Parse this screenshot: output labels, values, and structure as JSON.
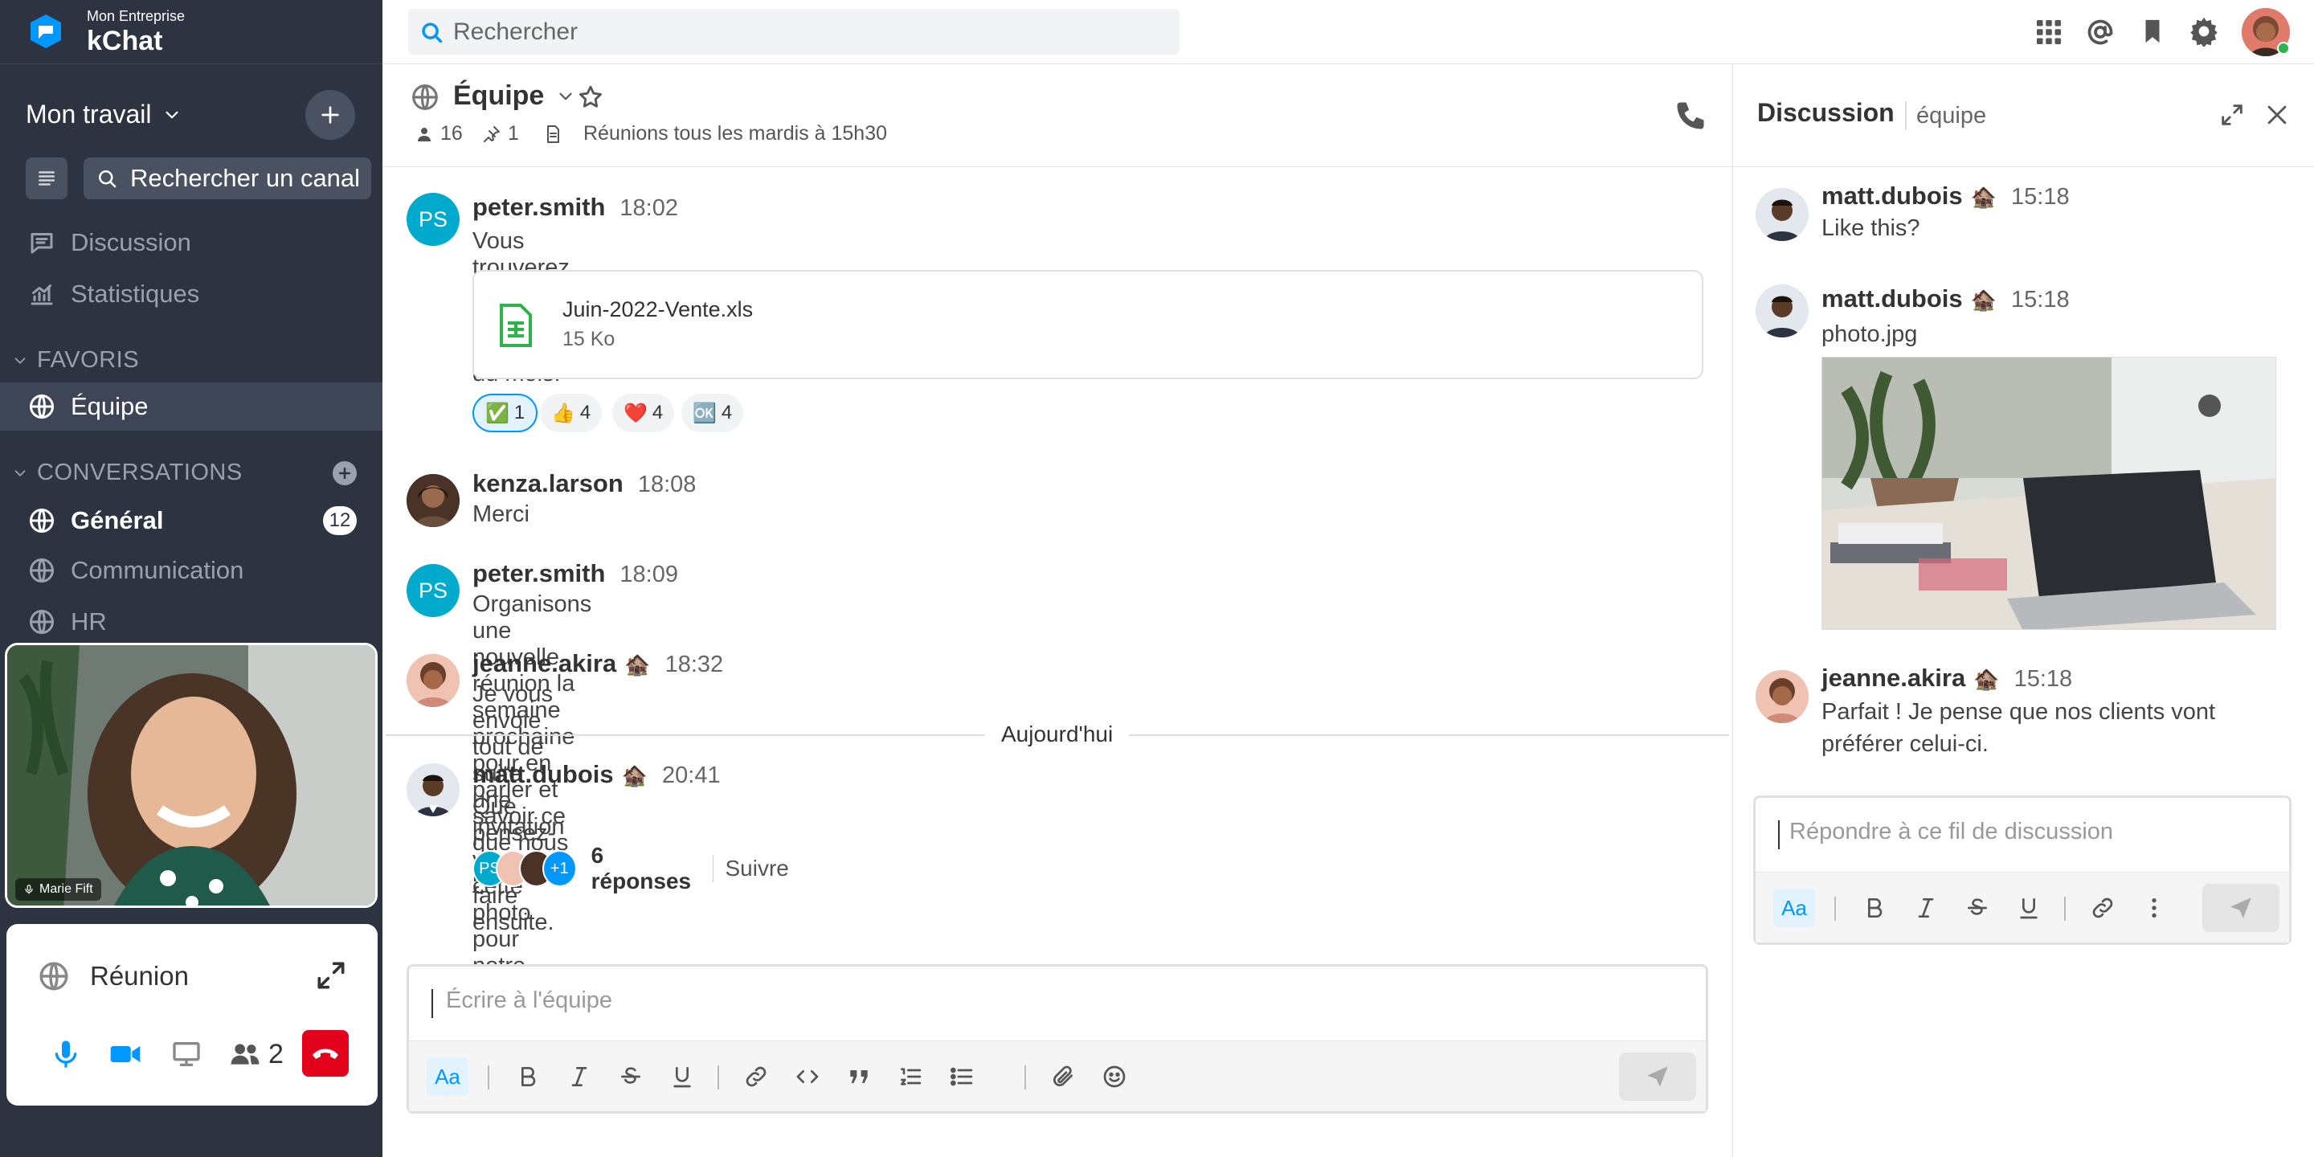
{
  "workspace": {
    "org": "Mon Entreprise",
    "app": "kChat"
  },
  "sidebar": {
    "work_menu": "Mon travail",
    "channel_search": "Rechercher un canal",
    "nav": [
      {
        "label": "Discussion",
        "icon": "threads-icon"
      },
      {
        "label": "Statistiques",
        "icon": "insights-icon"
      }
    ],
    "favorites_title": "FAVORIS",
    "favorites": [
      {
        "label": "Équipe"
      }
    ],
    "conversations_title": "CONVERSATIONS",
    "conversations": [
      {
        "label": "Général",
        "badge": "12",
        "unread": true
      },
      {
        "label": "Communication"
      },
      {
        "label": "HR"
      }
    ]
  },
  "video": {
    "participant": "Marie Fift"
  },
  "meeting": {
    "title": "Réunion",
    "participants": "2"
  },
  "topbar": {
    "search_placeholder": "Rechercher"
  },
  "channel": {
    "name": "Équipe",
    "members": "16",
    "pinned": "1",
    "header": "Réunions tous les mardis à 15h30"
  },
  "messages": [
    {
      "author": "peter.smith",
      "time": "18:02",
      "text": "Vous trouverez ici la dernière analyse du mois.",
      "avatar": "PS",
      "file": {
        "name": "Juin-2022-Vente.xls",
        "size": "15 Ko"
      },
      "reactions": [
        {
          "emoji": "✅",
          "count": "1"
        },
        {
          "emoji": "👍",
          "count": "4"
        },
        {
          "emoji": "❤️",
          "count": "4"
        },
        {
          "emoji": "🆗",
          "count": "4"
        }
      ]
    },
    {
      "author": "kenza.larson",
      "time": "18:08",
      "text": "Merci"
    },
    {
      "author": "peter.smith",
      "time": "18:09",
      "text": "Organisons une nouvelle réunion la semaine prochaine pour en parler et savoir ce que nous pouvons faire ensuite.",
      "avatar": "PS"
    },
    {
      "author": "jeanne.akira",
      "time": "18:32",
      "text": "Je vous envoie tout de suite une invitation"
    },
    {
      "author": "matt.dubois",
      "time": "20:41",
      "text": "Que pensez-vous de cette photo pour notre prochain article ?",
      "thread": {
        "replies": "6 réponses",
        "follow": "Suivre",
        "more": "+1",
        "ps": "PS"
      }
    }
  ],
  "date_separator": "Aujourd'hui",
  "composer": {
    "placeholder": "Écrire à l'équipe",
    "format": "Aa"
  },
  "thread_panel": {
    "title": "Discussion",
    "channel": "équipe",
    "messages": [
      {
        "author": "matt.dubois",
        "time": "15:18",
        "text": "Like this?"
      },
      {
        "author": "matt.dubois",
        "time": "15:18",
        "text": "photo.jpg"
      },
      {
        "author": "jeanne.akira",
        "time": "15:18",
        "text": "Parfait ! Je pense que nos clients vont préférer celui-ci."
      }
    ],
    "placeholder": "Répondre à ce fil de discussion",
    "format": "Aa"
  },
  "colors": {
    "sidebar": "#2d3340",
    "accent": "#0098ff",
    "hangup": "#e3001b",
    "status_online": "#2cb34a"
  }
}
